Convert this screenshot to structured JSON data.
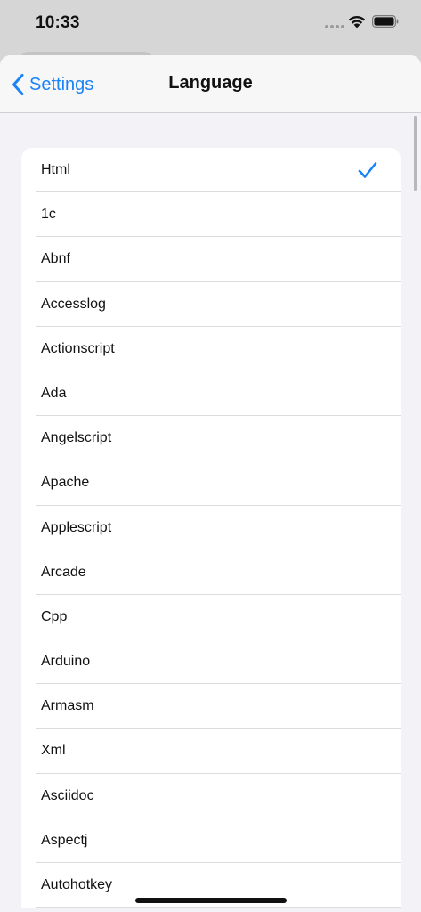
{
  "status_bar": {
    "time": "10:33"
  },
  "nav": {
    "back_label": "Settings",
    "title": "Language"
  },
  "languages": [
    {
      "label": "Html",
      "selected": true
    },
    {
      "label": "1c",
      "selected": false
    },
    {
      "label": "Abnf",
      "selected": false
    },
    {
      "label": "Accesslog",
      "selected": false
    },
    {
      "label": "Actionscript",
      "selected": false
    },
    {
      "label": "Ada",
      "selected": false
    },
    {
      "label": "Angelscript",
      "selected": false
    },
    {
      "label": "Apache",
      "selected": false
    },
    {
      "label": "Applescript",
      "selected": false
    },
    {
      "label": "Arcade",
      "selected": false
    },
    {
      "label": "Cpp",
      "selected": false
    },
    {
      "label": "Arduino",
      "selected": false
    },
    {
      "label": "Armasm",
      "selected": false
    },
    {
      "label": "Xml",
      "selected": false
    },
    {
      "label": "Asciidoc",
      "selected": false
    },
    {
      "label": "Aspectj",
      "selected": false
    },
    {
      "label": "Autohotkey",
      "selected": false
    }
  ],
  "colors": {
    "accent": "#1a82f7",
    "background": "#f2f2f7",
    "card": "#ffffff"
  },
  "icons": {
    "back": "chevron-left-icon",
    "selected": "checkmark-icon"
  }
}
